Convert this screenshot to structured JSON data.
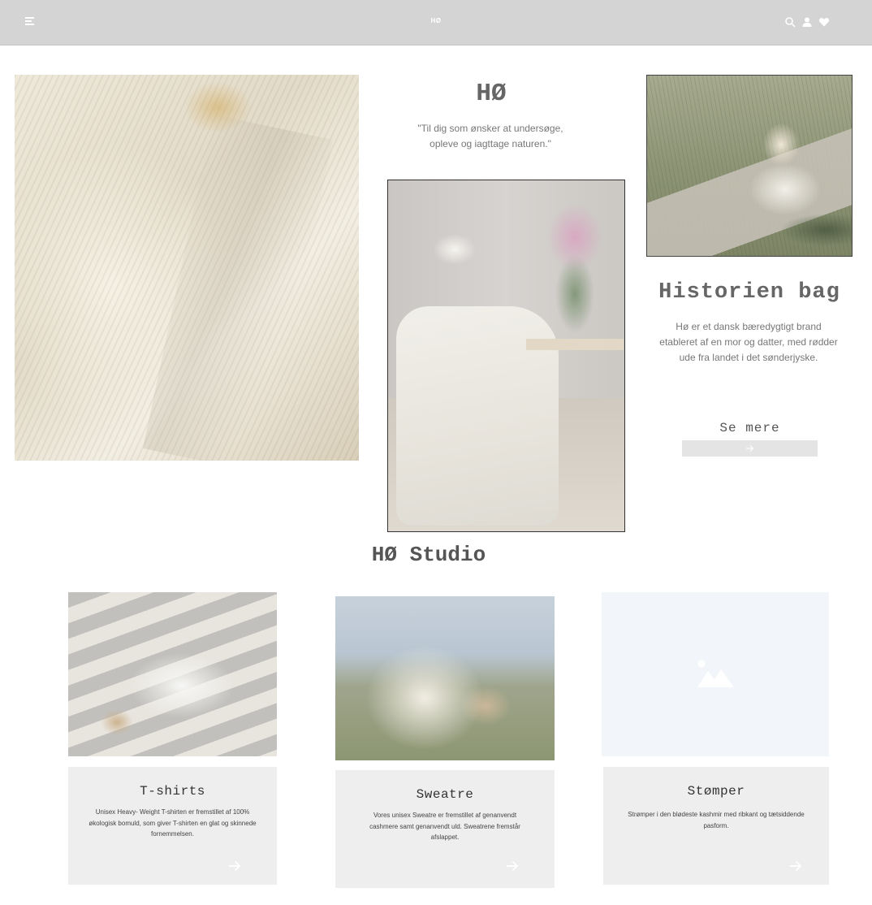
{
  "header": {
    "logo": "HØ",
    "icons": [
      "menu-icon",
      "search-icon",
      "user-icon",
      "heart-icon"
    ]
  },
  "hero": {
    "brand_title": "HØ",
    "quote": "\"Til dig som ønsker at undersøge, opleve og iagttage naturen.\"",
    "story_title": "Historien bag",
    "story_text": "Hø er et dansk bæredygtigt brand etableret af en mor og datter, med rødder ude fra landet i det sønderjyske.",
    "see_more_label": "Se mere"
  },
  "studio": {
    "title": "HØ Studio",
    "cards": [
      {
        "title": "T-shirts",
        "text": "Unisex Heavy- Weight T-shirten er fremstillet af 100% økologisk bomuld, som giver T-shirten en glat og skinnede fornemmelsen."
      },
      {
        "title": "Sweatre",
        "text": "Vores unisex Sweatre er fremstillet af genanvendt cashmere samt genanvendt uld. Sweatrene fremstår afslappet."
      },
      {
        "title": "Stømper",
        "text": "Strømper i den blødeste kashmir med ribkant og tætsiddende pasform."
      }
    ]
  },
  "colors": {
    "header_bg": "#d4d4d4",
    "card_bg": "#eeeeee",
    "button_bg": "#e4e4e4",
    "placeholder_bg": "#f2f6fb"
  }
}
